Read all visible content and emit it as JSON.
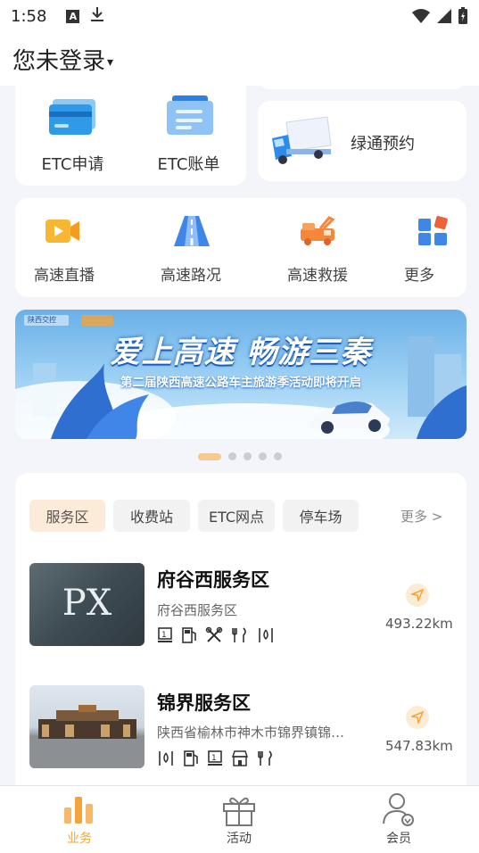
{
  "status_bar": {
    "time": "1:58",
    "notif_a": "A"
  },
  "header": {
    "login_text": "您未登录",
    "caret": "▾"
  },
  "etc_card": {
    "items": [
      {
        "label": "ETC申请",
        "icon": "credit-card-icon"
      },
      {
        "label": "ETC账单",
        "icon": "bill-icon"
      }
    ]
  },
  "green_pass": {
    "label": "绿通预约",
    "icon": "truck-icon"
  },
  "quick_links": {
    "items": [
      {
        "label": "高速直播",
        "icon": "video-camera-icon"
      },
      {
        "label": "高速路况",
        "icon": "road-icon"
      },
      {
        "label": "高速救援",
        "icon": "tow-truck-icon"
      },
      {
        "label": "更多",
        "icon": "grid-icon"
      }
    ]
  },
  "banner": {
    "logo_text": "陕西交控",
    "headline": "爱上高速 畅游三秦",
    "subline": "第二届陕西高速公路车主旅游季活动即将开启"
  },
  "carousel": {
    "count": 5,
    "active": 0
  },
  "service": {
    "tabs": [
      {
        "label": "服务区",
        "active": true
      },
      {
        "label": "收费站",
        "active": false
      },
      {
        "label": "ETC网点",
        "active": false
      },
      {
        "label": "停车场",
        "active": false
      }
    ],
    "more_label": "更多 >",
    "items": [
      {
        "name": "府谷西服务区",
        "address": "府谷西服务区",
        "features": [
          "toilet-icon",
          "fuel-icon",
          "repair-icon",
          "restaurant-icon",
          "water-icon"
        ],
        "distance": "493.22km",
        "image_text": "PX"
      },
      {
        "name": "锦界服务区",
        "address": "陕西省榆林市神木市锦界镇锦…",
        "features": [
          "water-icon",
          "fuel-icon",
          "toilet-icon",
          "shop-icon",
          "restaurant-icon"
        ],
        "distance": "547.83km",
        "image_text": ""
      }
    ]
  },
  "tabbar": {
    "items": [
      {
        "label": "业务",
        "icon": "bar-chart-icon",
        "active": true
      },
      {
        "label": "活动",
        "icon": "gift-icon",
        "active": false
      },
      {
        "label": "会员",
        "icon": "member-icon",
        "active": false
      }
    ]
  },
  "colors": {
    "accent": "#f5a33a",
    "primary_blue": "#3a8ee8"
  }
}
